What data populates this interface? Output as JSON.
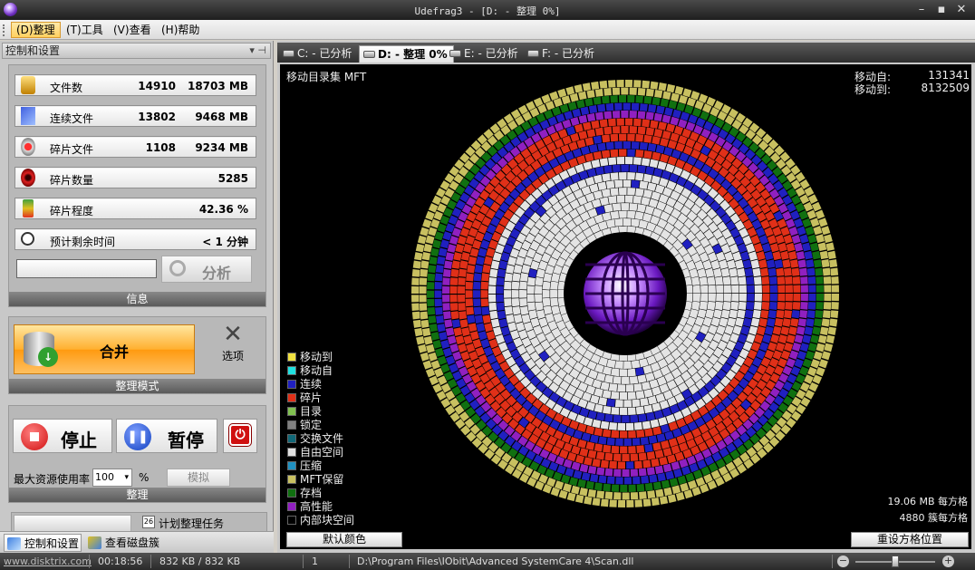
{
  "window": {
    "title": "Udefrag3 - [D: - 整理 0%]"
  },
  "menu": [
    {
      "label": "(D)整理",
      "selected": true
    },
    {
      "label": "(T)工具",
      "selected": false
    },
    {
      "label": "(V)查看",
      "selected": false
    },
    {
      "label": "(H)帮助",
      "selected": false
    }
  ],
  "left_panel": {
    "header": "控制和设置",
    "stats": [
      {
        "label": "文件数",
        "v1": "14910",
        "v2": "18703 MB",
        "icon": "files-icon"
      },
      {
        "label": "连续文件",
        "v1": "13802",
        "v2": "9468 MB",
        "icon": "contiguous-files-icon"
      },
      {
        "label": "碎片文件",
        "v1": "1108",
        "v2": "9234 MB",
        "icon": "fragmented-files-icon"
      },
      {
        "label": "碎片数量",
        "v1": "",
        "v2": "5285",
        "icon": "fragment-count-icon"
      },
      {
        "label": "碎片程度",
        "v1": "",
        "v2": "42.36 %",
        "icon": "fragmentation-level-icon"
      },
      {
        "label": "预计剩余时间",
        "v1": "",
        "v2": "< 1 分钟",
        "icon": "stopwatch-icon"
      }
    ],
    "analyze_button": "分析",
    "info_footer": "信息",
    "merge_button": "合并",
    "options_label": "选项",
    "mode_footer": "整理模式",
    "stop_button": "停止",
    "pause_button": "暂停",
    "max_resource_label": "最大资源使用率",
    "max_resource_value": "100",
    "percent_sign": "%",
    "simulate_button": "模拟",
    "defrag_footer": "整理",
    "schedule_label": "计划整理任务",
    "bottom_tabs": [
      "控制和设置",
      "查看磁盘簇"
    ]
  },
  "tabs": [
    {
      "label": "C: - 已分析",
      "active": false
    },
    {
      "label": "D: - 整理 0%",
      "active": true
    },
    {
      "label": "E: - 已分析",
      "active": false
    },
    {
      "label": "F: - 已分析",
      "active": false
    }
  ],
  "map": {
    "status": "移动目录集 MFT",
    "move_from_label": "移动自:",
    "move_from_value": "131341",
    "move_to_label": "移动到:",
    "move_to_value": "8132509",
    "legend": [
      {
        "label": "移动到",
        "color": "#f0e040"
      },
      {
        "label": "移动自",
        "color": "#20e0e0"
      },
      {
        "label": "连续",
        "color": "#2020c0"
      },
      {
        "label": "碎片",
        "color": "#e03018"
      },
      {
        "label": "目录",
        "color": "#80c050"
      },
      {
        "label": "锁定",
        "color": "#808080"
      },
      {
        "label": "交换文件",
        "color": "#106878"
      },
      {
        "label": "自由空间",
        "color": "#e0e0e0"
      },
      {
        "label": "压缩",
        "color": "#2090c0"
      },
      {
        "label": "MFT保留",
        "color": "#c8c060"
      },
      {
        "label": "存档",
        "color": "#107010"
      },
      {
        "label": "高性能",
        "color": "#9020c0"
      },
      {
        "label": "内部块空间",
        "color": "#000000"
      }
    ],
    "cluster_size_info": "19.06 MB 每方格",
    "cluster_count_info": "4880 簇每方格",
    "default_colors_button": "默认颜色",
    "reset_grid_button": "重设方格位置"
  },
  "statusbar": {
    "website": "www.disktrix.com",
    "elapsed": "00:18:56",
    "memory": "832 KB / 832 KB",
    "count": "1",
    "path": "D:\\Program Files\\IObit\\Advanced SystemCare 4\\Scan.dll"
  }
}
